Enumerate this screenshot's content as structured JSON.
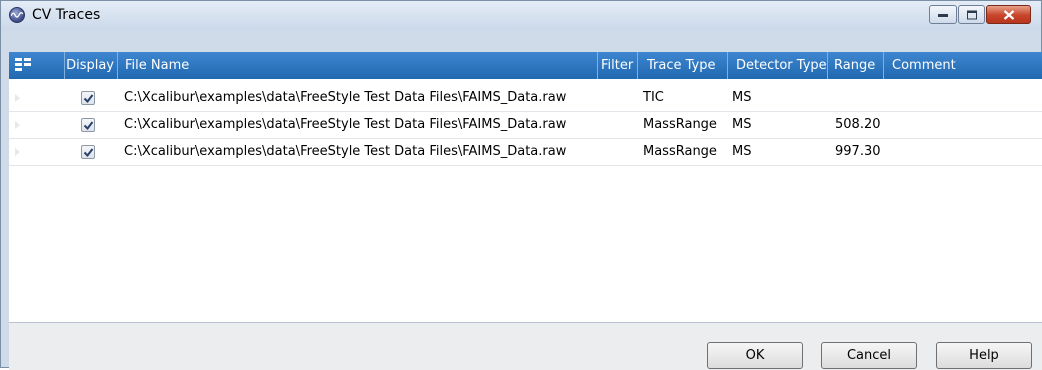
{
  "window": {
    "title": "CV Traces"
  },
  "columns": {
    "display": "Display",
    "file_name": "File Name",
    "filter": "Filter",
    "trace_type": "Trace Type",
    "detector_type": "Detector Type",
    "range": "Range",
    "comment": "Comment"
  },
  "rows": [
    {
      "display": true,
      "file_name": "C:\\Xcalibur\\examples\\data\\FreeStyle Test Data Files\\FAIMS_Data.raw",
      "filter": "",
      "trace_type": "TIC",
      "detector_type": "MS",
      "range": "",
      "comment": ""
    },
    {
      "display": true,
      "file_name": "C:\\Xcalibur\\examples\\data\\FreeStyle Test Data Files\\FAIMS_Data.raw",
      "filter": "",
      "trace_type": "MassRange",
      "detector_type": "MS",
      "range": "508.20",
      "comment": ""
    },
    {
      "display": true,
      "file_name": "C:\\Xcalibur\\examples\\data\\FreeStyle Test Data Files\\FAIMS_Data.raw",
      "filter": "",
      "trace_type": "MassRange",
      "detector_type": "MS",
      "range": "997.30",
      "comment": ""
    }
  ],
  "buttons": {
    "ok": "OK",
    "cancel": "Cancel",
    "help": "Help"
  },
  "icons": {
    "app": "cv-app-icon",
    "column_chooser": "column-chooser-icon",
    "minimize": "minimize-icon",
    "maximize": "maximize-icon",
    "close": "close-icon"
  },
  "colors": {
    "header": "#2d77c2",
    "close_button": "#c8442a",
    "titlebar": "#cbd9ea"
  }
}
